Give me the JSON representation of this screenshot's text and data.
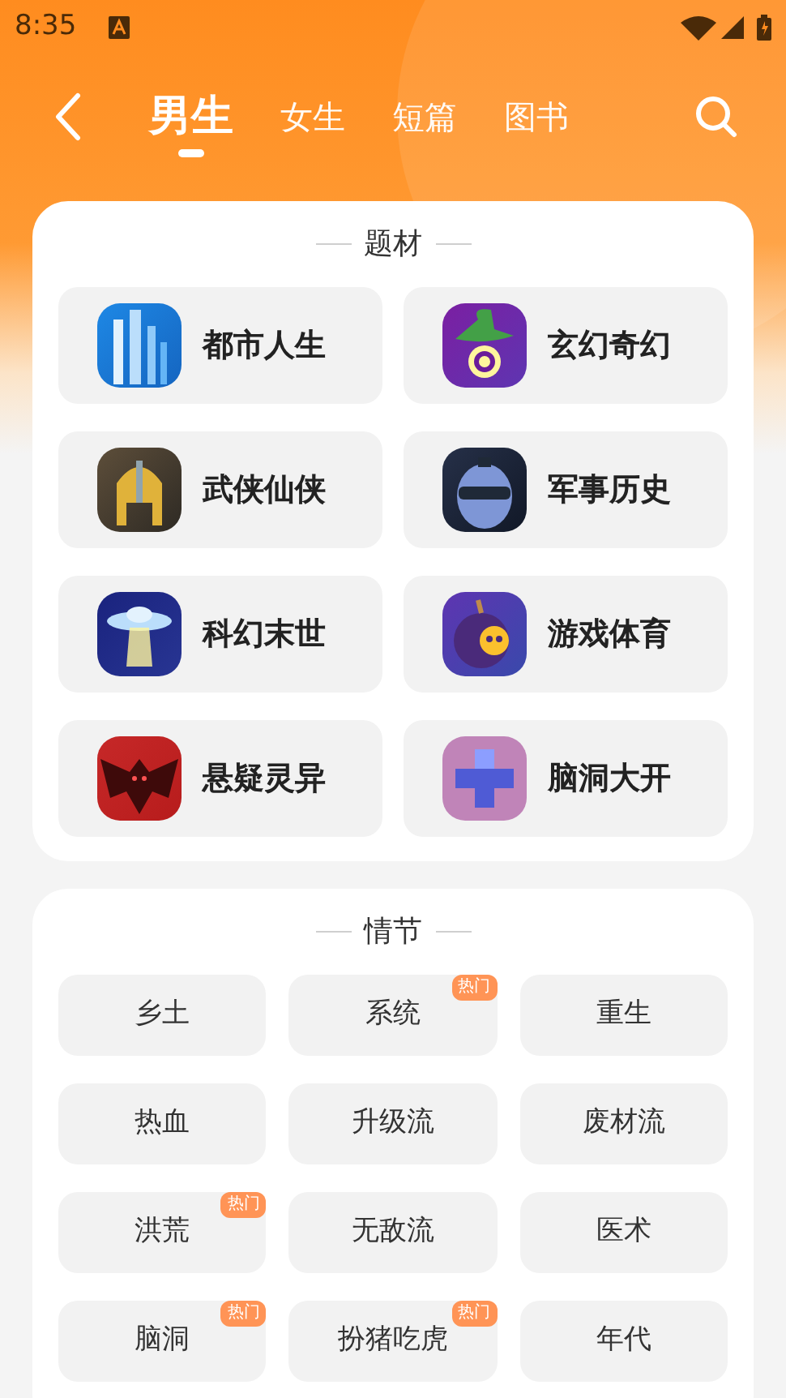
{
  "status_bar": {
    "time": "8:35"
  },
  "nav": {
    "tabs": [
      {
        "label": "男生",
        "selected": true
      },
      {
        "label": "女生",
        "selected": false
      },
      {
        "label": "短篇",
        "selected": false
      },
      {
        "label": "图书",
        "selected": false
      }
    ]
  },
  "genres": {
    "title": "题材",
    "items": [
      {
        "label": "都市人生"
      },
      {
        "label": "玄幻奇幻"
      },
      {
        "label": "武侠仙侠"
      },
      {
        "label": "军事历史"
      },
      {
        "label": "科幻末世"
      },
      {
        "label": "游戏体育"
      },
      {
        "label": "悬疑灵异"
      },
      {
        "label": "脑洞大开"
      }
    ]
  },
  "plots": {
    "title": "情节",
    "items": [
      {
        "label": "乡土",
        "hot": false
      },
      {
        "label": "系统",
        "hot": true,
        "badge": "热门"
      },
      {
        "label": "重生",
        "hot": false
      },
      {
        "label": "热血",
        "hot": false
      },
      {
        "label": "升级流",
        "hot": false
      },
      {
        "label": "废材流",
        "hot": false
      },
      {
        "label": "洪荒",
        "hot": true,
        "badge": "热门"
      },
      {
        "label": "无敌流",
        "hot": false
      },
      {
        "label": "医术",
        "hot": false
      },
      {
        "label": "脑洞",
        "hot": true,
        "badge": "热门"
      },
      {
        "label": "扮猪吃虎",
        "hot": true,
        "badge": "热门"
      },
      {
        "label": "年代",
        "hot": false
      }
    ]
  }
}
